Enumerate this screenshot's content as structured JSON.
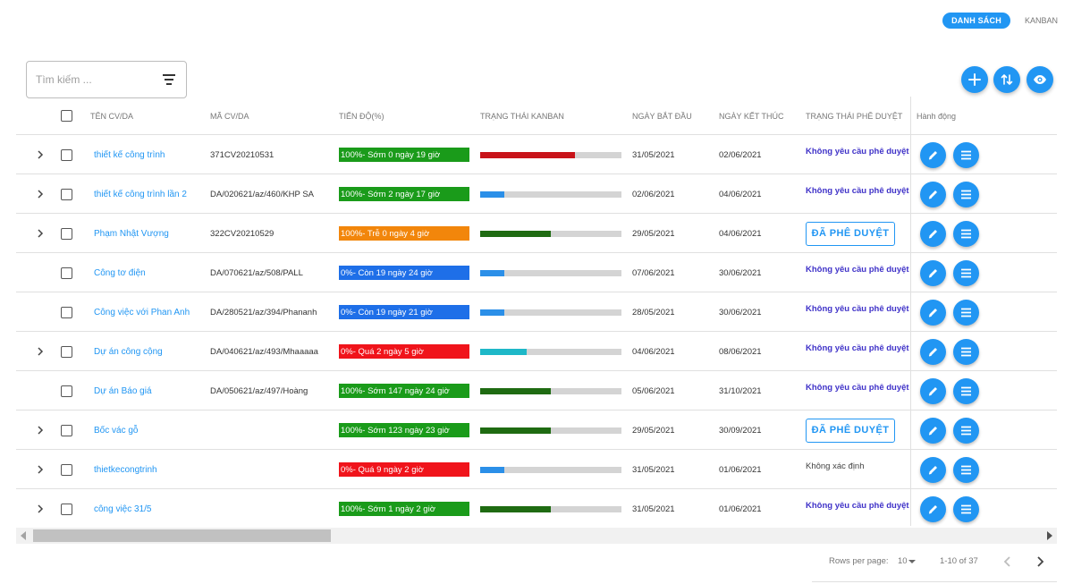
{
  "view_toggle": {
    "list_label": "DANH SÁCH",
    "kanban_label": "KANBAN"
  },
  "search": {
    "placeholder": "Tìm kiếm ...",
    "value": ""
  },
  "toolbar": {
    "add_icon": "plus-icon",
    "sort_icon": "sort-arrows-icon",
    "view_icon": "eye-icon"
  },
  "colors": {
    "accent": "#2196f3",
    "green": "#1a9b1a",
    "orange": "#f2860b",
    "blue": "#1e6fe8",
    "red": "#f0141b",
    "kanban_red": "#c8141a",
    "kanban_green": "#1f6b12",
    "kanban_blue": "#2b8fe8",
    "kanban_teal": "#1eb8c8",
    "approval_text": "#3f32c8"
  },
  "table": {
    "headers": {
      "name": "TÊN CV/DA",
      "code": "MÃ CV/DA",
      "progress": "TIẾN ĐỘ(%)",
      "kanban": "TRẠNG THÁI KANBAN",
      "start": "NGÀY BẮT ĐẦU",
      "end": "NGÀY KẾT THÚC",
      "approval": "TRẠNG THÁI PHÊ DUYỆT",
      "actions": "Hành động"
    },
    "rows": [
      {
        "expandable": true,
        "name": "thiết kế công trình",
        "code": "371CV20210531",
        "progress": "100%- Sớm 0 ngày 19 giờ",
        "progress_color": "#1a9b1a",
        "kanban_color": "#c8141a",
        "kanban_fraction": 0.67,
        "start": "31/05/2021",
        "end": "02/06/2021",
        "approval_type": "text",
        "approval": "Không yêu cầu phê duyệt"
      },
      {
        "expandable": true,
        "name": "thiết kế công trình lần 2",
        "code": "DA/020621/az/460/KHP SA",
        "progress": "100%- Sớm 2 ngày 17 giờ",
        "progress_color": "#1a9b1a",
        "kanban_color": "#2b8fe8",
        "kanban_fraction": 0.17,
        "start": "02/06/2021",
        "end": "04/06/2021",
        "approval_type": "text",
        "approval": "Không yêu cầu phê duyệt"
      },
      {
        "expandable": true,
        "name": "Phạm Nhật Vượng",
        "code": "322CV20210529",
        "progress": "100%- Trễ 0 ngày 4 giờ",
        "progress_color": "#f2860b",
        "kanban_color": "#1f6b12",
        "kanban_fraction": 0.5,
        "start": "29/05/2021",
        "end": "04/06/2021",
        "approval_type": "button",
        "approval": "ĐÃ PHÊ DUYỆT"
      },
      {
        "expandable": false,
        "name": "Công tơ điện",
        "code": "DA/070621/az/508/PALL",
        "progress": "0%- Còn 19 ngày 24 giờ",
        "progress_color": "#1e6fe8",
        "kanban_color": "#2b8fe8",
        "kanban_fraction": 0.17,
        "start": "07/06/2021",
        "end": "30/06/2021",
        "approval_type": "text",
        "approval": "Không yêu cầu phê duyệt"
      },
      {
        "expandable": false,
        "name": "Công việc với Phan Anh",
        "code": "DA/280521/az/394/Phananh",
        "progress": "0%- Còn 19 ngày 21 giờ",
        "progress_color": "#1e6fe8",
        "kanban_color": "#2b8fe8",
        "kanban_fraction": 0.17,
        "start": "28/05/2021",
        "end": "30/06/2021",
        "approval_type": "text",
        "approval": "Không yêu cầu phê duyệt"
      },
      {
        "expandable": true,
        "name": "Dự án công cộng",
        "code": "DA/040621/az/493/Mhaaaaa",
        "progress": "0%- Quá 2 ngày 5 giờ",
        "progress_color": "#f0141b",
        "kanban_color": "#1eb8c8",
        "kanban_fraction": 0.33,
        "start": "04/06/2021",
        "end": "08/06/2021",
        "approval_type": "text",
        "approval": "Không yêu cầu phê duyệt"
      },
      {
        "expandable": false,
        "name": "Dự án Báo giá",
        "code": "DA/050621/az/497/Hoàng",
        "progress": "100%- Sớm 147 ngày 24 giờ",
        "progress_color": "#1a9b1a",
        "kanban_color": "#1f6b12",
        "kanban_fraction": 0.5,
        "start": "05/06/2021",
        "end": "31/10/2021",
        "approval_type": "text",
        "approval": "Không yêu cầu phê duyệt"
      },
      {
        "expandable": true,
        "name": "Bốc vác gỗ",
        "code": "",
        "progress": "100%- Sớm 123 ngày 23 giờ",
        "progress_color": "#1a9b1a",
        "kanban_color": "#1f6b12",
        "kanban_fraction": 0.5,
        "start": "29/05/2021",
        "end": "30/09/2021",
        "approval_type": "button",
        "approval": "ĐÃ PHÊ DUYỆT"
      },
      {
        "expandable": true,
        "name": "thietkecongtrinh",
        "code": "",
        "progress": "0%- Quá 9 ngày 2 giờ",
        "progress_color": "#f0141b",
        "kanban_color": "#2b8fe8",
        "kanban_fraction": 0.17,
        "start": "31/05/2021",
        "end": "01/06/2021",
        "approval_type": "plain",
        "approval": "Không xác định"
      },
      {
        "expandable": true,
        "name": "công việc 31/5",
        "code": "",
        "progress": "100%- Sớm 1 ngày 2 giờ",
        "progress_color": "#1a9b1a",
        "kanban_color": "#1f6b12",
        "kanban_fraction": 0.5,
        "start": "31/05/2021",
        "end": "01/06/2021",
        "approval_type": "text",
        "approval": "Không yêu cầu phê duyệt"
      }
    ],
    "row_action_icons": [
      "pencil-icon",
      "menu-lines-icon"
    ]
  },
  "pagination": {
    "rows_per_page_label": "Rows per page:",
    "rows_per_page_value": "10",
    "range": "1-10 of 37"
  }
}
